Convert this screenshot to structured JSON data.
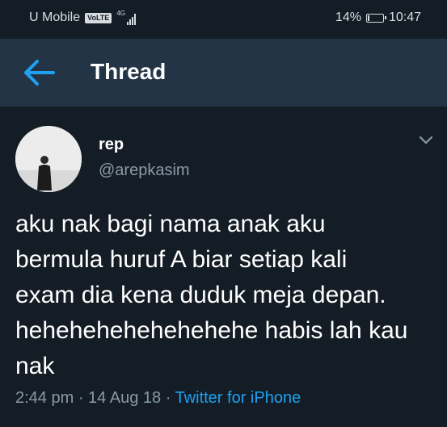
{
  "status_bar": {
    "carrier": "U Mobile",
    "volte_badge": "VoLTE",
    "network_type": "4G",
    "battery_percent": "14%",
    "battery_level": 0.14,
    "time": "10:47"
  },
  "header": {
    "title": "Thread",
    "back_icon": "arrow-left-icon",
    "accent": "#1da1f2",
    "background": "#243447"
  },
  "tweet": {
    "display_name": "rep",
    "handle": "@arepkasim",
    "text": "aku nak bagi nama anak aku\nbermula huruf A biar setiap kali\nexam dia kena duduk meja depan.\nhehehehehehehehehe habis lah kau\nnak",
    "time": "2:44 pm",
    "separator": " · ",
    "date": "14 Aug 18",
    "source": "Twitter for iPhone",
    "menu_icon": "chevron-down-icon"
  },
  "colors": {
    "background": "#141d26",
    "secondary_text": "#8899a6",
    "link": "#1da1f2"
  }
}
